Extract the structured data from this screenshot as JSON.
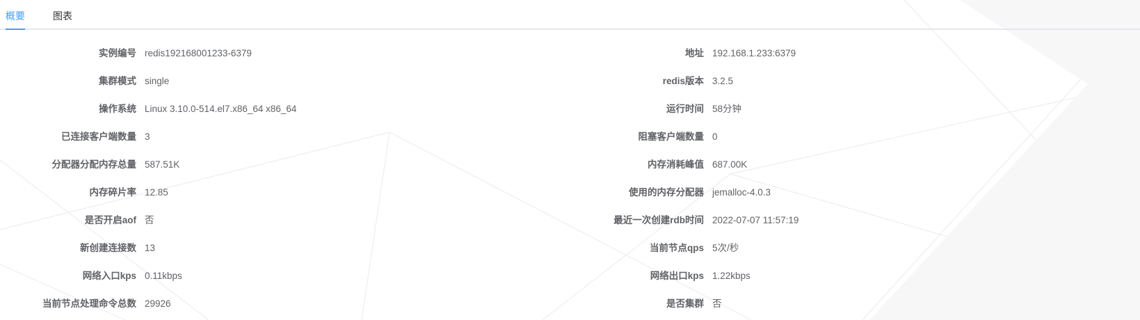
{
  "tabs": [
    {
      "label": "概要",
      "active": true
    },
    {
      "label": "图表",
      "active": false
    }
  ],
  "colors": {
    "accent": "#409eff",
    "text": "#606266",
    "divider": "#e4e7ed"
  },
  "rows": [
    {
      "left_label": "实例编号",
      "left_value": "redis192168001233-6379",
      "right_label": "地址",
      "right_value": "192.168.1.233:6379"
    },
    {
      "left_label": "集群模式",
      "left_value": "single",
      "right_label": "redis版本",
      "right_value": "3.2.5"
    },
    {
      "left_label": "操作系统",
      "left_value": "Linux 3.10.0-514.el7.x86_64 x86_64",
      "right_label": "运行时间",
      "right_value": "58分钟"
    },
    {
      "left_label": "已连接客户端数量",
      "left_value": "3",
      "right_label": "阻塞客户端数量",
      "right_value": "0"
    },
    {
      "left_label": "分配器分配内存总量",
      "left_value": "587.51K",
      "right_label": "内存消耗峰值",
      "right_value": "687.00K"
    },
    {
      "left_label": "内存碎片率",
      "left_value": "12.85",
      "right_label": "使用的内存分配器",
      "right_value": "jemalloc-4.0.3"
    },
    {
      "left_label": "是否开启aof",
      "left_value": "否",
      "right_label": "最近一次创建rdb时间",
      "right_value": "2022-07-07 11:57:19"
    },
    {
      "left_label": "新创建连接数",
      "left_value": "13",
      "right_label": "当前节点qps",
      "right_value": "5次/秒"
    },
    {
      "left_label": "网络入口kps",
      "left_value": "0.11kbps",
      "right_label": "网络出口kps",
      "right_value": "1.22kbps"
    },
    {
      "left_label": "当前节点处理命令总数",
      "left_value": "29926",
      "right_label": "是否集群",
      "right_value": "否"
    }
  ]
}
